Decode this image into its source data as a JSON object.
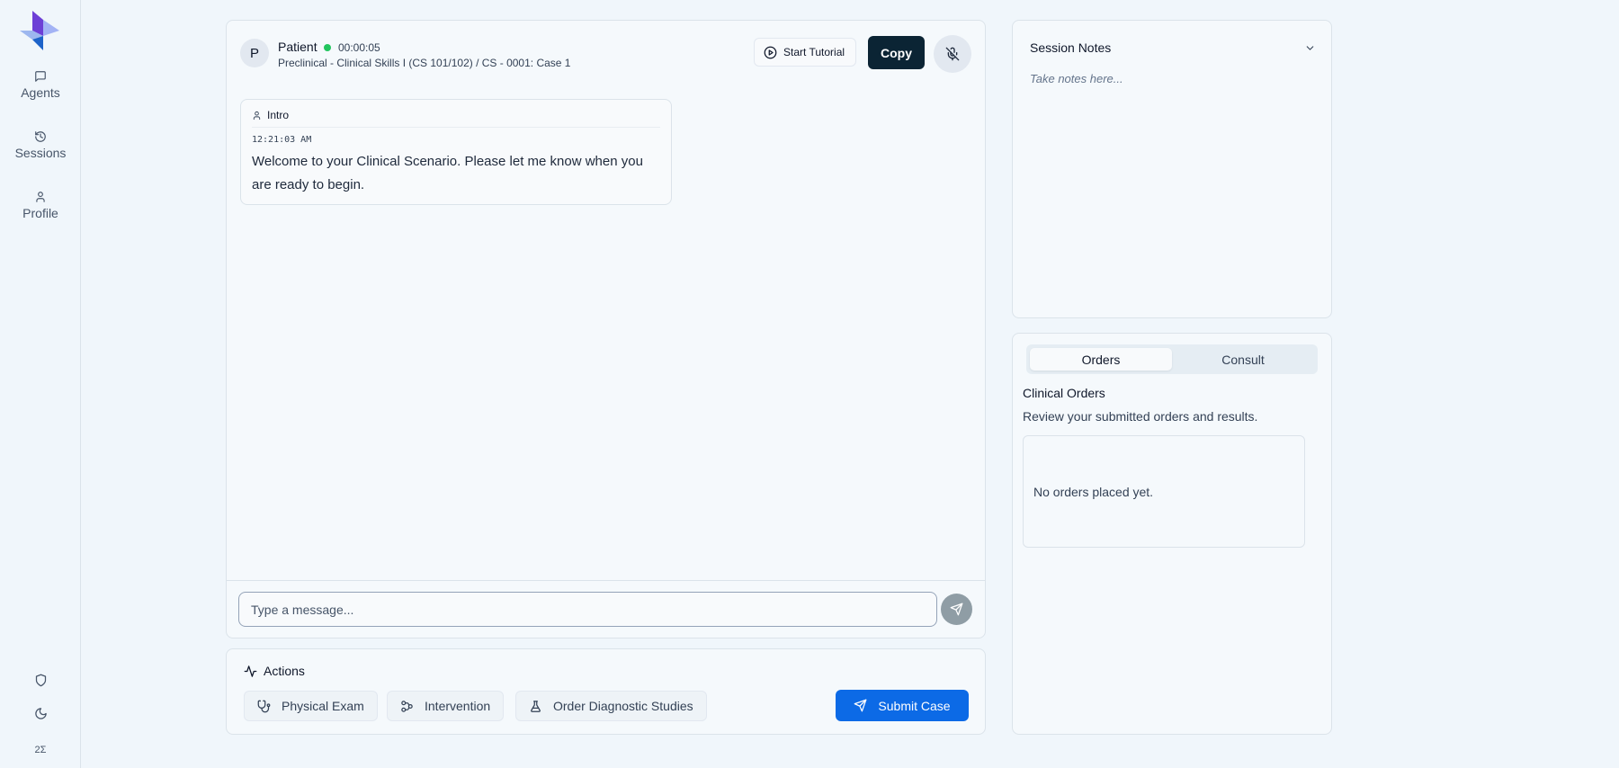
{
  "sidebar": {
    "items": [
      {
        "label": "Agents",
        "icon": "message-square-icon"
      },
      {
        "label": "Sessions",
        "icon": "history-icon"
      },
      {
        "label": "Profile",
        "icon": "user-icon"
      }
    ],
    "bottom": {
      "version": "2Σ"
    }
  },
  "chat": {
    "avatar_letter": "P",
    "patient_name": "Patient",
    "timer": "00:00:05",
    "breadcrumb": "Preclinical - Clinical Skills I (CS 101/102) / CS - 0001: Case 1",
    "tutorial_label": "Start Tutorial",
    "copy_label": "Copy",
    "message": {
      "sender": "Intro",
      "time": "12:21:03 AM",
      "text": "Welcome to your Clinical Scenario. Please let me know when you are ready to begin."
    },
    "input_placeholder": "Type a message..."
  },
  "actions": {
    "title": "Actions",
    "buttons": [
      {
        "label": "Physical Exam",
        "icon": "stethoscope-icon"
      },
      {
        "label": "Intervention",
        "icon": "workflow-icon"
      },
      {
        "label": "Order Diagnostic Studies",
        "icon": "flask-icon"
      }
    ],
    "submit_label": "Submit Case"
  },
  "notes": {
    "title": "Session Notes",
    "placeholder": "Take notes here..."
  },
  "orders": {
    "tabs": [
      {
        "label": "Orders",
        "active": true
      },
      {
        "label": "Consult",
        "active": false
      }
    ],
    "title": "Clinical Orders",
    "subtitle": "Review your submitted orders and results.",
    "empty_text": "No orders placed yet."
  },
  "colors": {
    "background": "#f0f6fb",
    "copy_button": "#0b2434",
    "submit_button": "#0c6ae6",
    "status_dot": "#22c55e"
  }
}
